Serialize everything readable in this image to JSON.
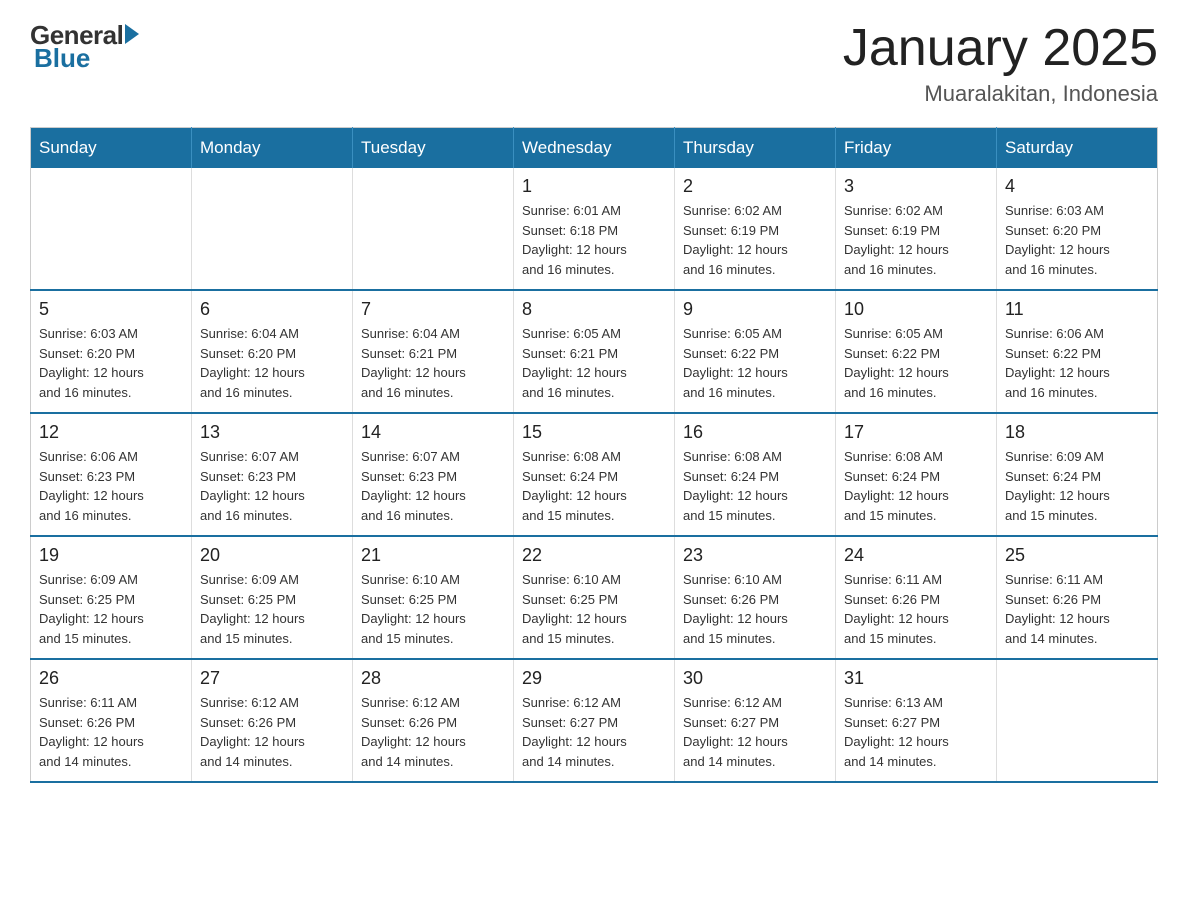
{
  "logo": {
    "general": "General",
    "blue": "Blue"
  },
  "header": {
    "title": "January 2025",
    "subtitle": "Muaralakitan, Indonesia"
  },
  "weekdays": [
    "Sunday",
    "Monday",
    "Tuesday",
    "Wednesday",
    "Thursday",
    "Friday",
    "Saturday"
  ],
  "weeks": [
    [
      {
        "day": "",
        "info": ""
      },
      {
        "day": "",
        "info": ""
      },
      {
        "day": "",
        "info": ""
      },
      {
        "day": "1",
        "info": "Sunrise: 6:01 AM\nSunset: 6:18 PM\nDaylight: 12 hours\nand 16 minutes."
      },
      {
        "day": "2",
        "info": "Sunrise: 6:02 AM\nSunset: 6:19 PM\nDaylight: 12 hours\nand 16 minutes."
      },
      {
        "day": "3",
        "info": "Sunrise: 6:02 AM\nSunset: 6:19 PM\nDaylight: 12 hours\nand 16 minutes."
      },
      {
        "day": "4",
        "info": "Sunrise: 6:03 AM\nSunset: 6:20 PM\nDaylight: 12 hours\nand 16 minutes."
      }
    ],
    [
      {
        "day": "5",
        "info": "Sunrise: 6:03 AM\nSunset: 6:20 PM\nDaylight: 12 hours\nand 16 minutes."
      },
      {
        "day": "6",
        "info": "Sunrise: 6:04 AM\nSunset: 6:20 PM\nDaylight: 12 hours\nand 16 minutes."
      },
      {
        "day": "7",
        "info": "Sunrise: 6:04 AM\nSunset: 6:21 PM\nDaylight: 12 hours\nand 16 minutes."
      },
      {
        "day": "8",
        "info": "Sunrise: 6:05 AM\nSunset: 6:21 PM\nDaylight: 12 hours\nand 16 minutes."
      },
      {
        "day": "9",
        "info": "Sunrise: 6:05 AM\nSunset: 6:22 PM\nDaylight: 12 hours\nand 16 minutes."
      },
      {
        "day": "10",
        "info": "Sunrise: 6:05 AM\nSunset: 6:22 PM\nDaylight: 12 hours\nand 16 minutes."
      },
      {
        "day": "11",
        "info": "Sunrise: 6:06 AM\nSunset: 6:22 PM\nDaylight: 12 hours\nand 16 minutes."
      }
    ],
    [
      {
        "day": "12",
        "info": "Sunrise: 6:06 AM\nSunset: 6:23 PM\nDaylight: 12 hours\nand 16 minutes."
      },
      {
        "day": "13",
        "info": "Sunrise: 6:07 AM\nSunset: 6:23 PM\nDaylight: 12 hours\nand 16 minutes."
      },
      {
        "day": "14",
        "info": "Sunrise: 6:07 AM\nSunset: 6:23 PM\nDaylight: 12 hours\nand 16 minutes."
      },
      {
        "day": "15",
        "info": "Sunrise: 6:08 AM\nSunset: 6:24 PM\nDaylight: 12 hours\nand 15 minutes."
      },
      {
        "day": "16",
        "info": "Sunrise: 6:08 AM\nSunset: 6:24 PM\nDaylight: 12 hours\nand 15 minutes."
      },
      {
        "day": "17",
        "info": "Sunrise: 6:08 AM\nSunset: 6:24 PM\nDaylight: 12 hours\nand 15 minutes."
      },
      {
        "day": "18",
        "info": "Sunrise: 6:09 AM\nSunset: 6:24 PM\nDaylight: 12 hours\nand 15 minutes."
      }
    ],
    [
      {
        "day": "19",
        "info": "Sunrise: 6:09 AM\nSunset: 6:25 PM\nDaylight: 12 hours\nand 15 minutes."
      },
      {
        "day": "20",
        "info": "Sunrise: 6:09 AM\nSunset: 6:25 PM\nDaylight: 12 hours\nand 15 minutes."
      },
      {
        "day": "21",
        "info": "Sunrise: 6:10 AM\nSunset: 6:25 PM\nDaylight: 12 hours\nand 15 minutes."
      },
      {
        "day": "22",
        "info": "Sunrise: 6:10 AM\nSunset: 6:25 PM\nDaylight: 12 hours\nand 15 minutes."
      },
      {
        "day": "23",
        "info": "Sunrise: 6:10 AM\nSunset: 6:26 PM\nDaylight: 12 hours\nand 15 minutes."
      },
      {
        "day": "24",
        "info": "Sunrise: 6:11 AM\nSunset: 6:26 PM\nDaylight: 12 hours\nand 15 minutes."
      },
      {
        "day": "25",
        "info": "Sunrise: 6:11 AM\nSunset: 6:26 PM\nDaylight: 12 hours\nand 14 minutes."
      }
    ],
    [
      {
        "day": "26",
        "info": "Sunrise: 6:11 AM\nSunset: 6:26 PM\nDaylight: 12 hours\nand 14 minutes."
      },
      {
        "day": "27",
        "info": "Sunrise: 6:12 AM\nSunset: 6:26 PM\nDaylight: 12 hours\nand 14 minutes."
      },
      {
        "day": "28",
        "info": "Sunrise: 6:12 AM\nSunset: 6:26 PM\nDaylight: 12 hours\nand 14 minutes."
      },
      {
        "day": "29",
        "info": "Sunrise: 6:12 AM\nSunset: 6:27 PM\nDaylight: 12 hours\nand 14 minutes."
      },
      {
        "day": "30",
        "info": "Sunrise: 6:12 AM\nSunset: 6:27 PM\nDaylight: 12 hours\nand 14 minutes."
      },
      {
        "day": "31",
        "info": "Sunrise: 6:13 AM\nSunset: 6:27 PM\nDaylight: 12 hours\nand 14 minutes."
      },
      {
        "day": "",
        "info": ""
      }
    ]
  ]
}
